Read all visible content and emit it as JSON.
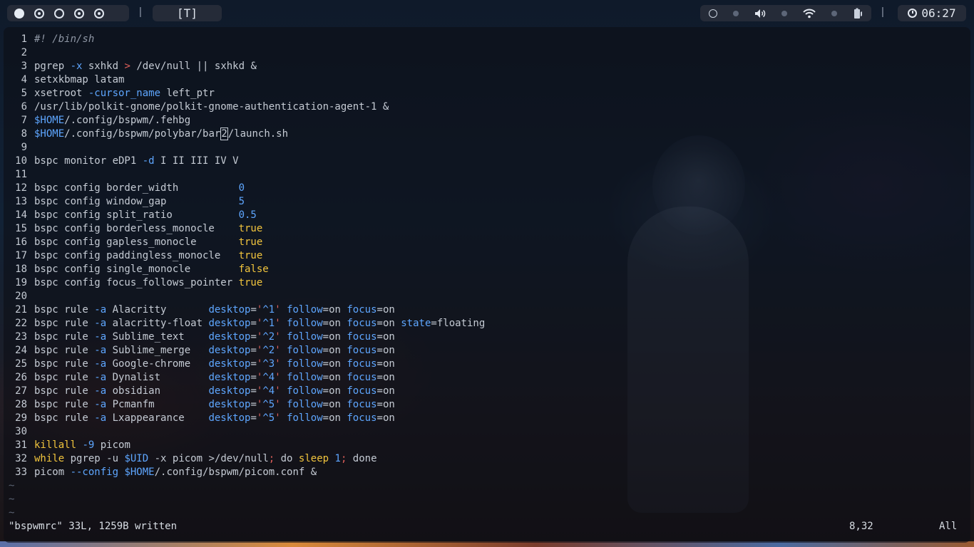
{
  "topbar": {
    "workspaces": [
      {
        "state": "active"
      },
      {
        "state": "occupied"
      },
      {
        "state": "empty"
      },
      {
        "state": "occupied"
      },
      {
        "state": "occupied"
      }
    ],
    "separator_left": "|",
    "separator_right": "|",
    "layout": "[T]",
    "icons": [
      "circle-icon",
      "dot-icon",
      "volume-icon",
      "dot-icon",
      "wifi-icon",
      "dot-icon",
      "battery-icon"
    ],
    "clock": "06:27"
  },
  "editor": {
    "lines": [
      {
        "n": "1",
        "segs": [
          [
            "c-com",
            "#! /bin/sh"
          ]
        ]
      },
      {
        "n": "2",
        "segs": []
      },
      {
        "n": "3",
        "segs": [
          [
            "",
            "pgrep "
          ],
          [
            "c-flag",
            "-x"
          ],
          [
            "",
            " sxhkd "
          ],
          [
            "c-op",
            ">"
          ],
          [
            "",
            " /dev/null || sxhkd &"
          ]
        ]
      },
      {
        "n": "4",
        "segs": [
          [
            "",
            "setxkbmap latam"
          ]
        ]
      },
      {
        "n": "5",
        "segs": [
          [
            "",
            "xsetroot "
          ],
          [
            "c-flag",
            "-cursor_name"
          ],
          [
            "",
            " left_ptr"
          ]
        ]
      },
      {
        "n": "6",
        "segs": [
          [
            "",
            "/usr/lib/polkit-gnome/polkit-gnome-authentication-agent-1 &"
          ]
        ]
      },
      {
        "n": "7",
        "segs": [
          [
            "c-var",
            "$HOME"
          ],
          [
            "",
            "/.config/bspwm/.fehbg"
          ]
        ]
      },
      {
        "n": "8",
        "segs": [
          [
            "c-var",
            "$HOME"
          ],
          [
            "",
            "/.config/bspwm/polybar/bar"
          ],
          [
            "cursor",
            "2"
          ],
          [
            "",
            "/launch.sh"
          ]
        ]
      },
      {
        "n": "9",
        "segs": []
      },
      {
        "n": "10",
        "segs": [
          [
            "",
            "bspc monitor eDP1 "
          ],
          [
            "c-flag",
            "-d"
          ],
          [
            "",
            " I II III IV V"
          ]
        ]
      },
      {
        "n": "11",
        "segs": []
      },
      {
        "n": "12",
        "segs": [
          [
            "",
            "bspc config border_width          "
          ],
          [
            "c-num",
            "0"
          ]
        ]
      },
      {
        "n": "13",
        "segs": [
          [
            "",
            "bspc config window_gap            "
          ],
          [
            "c-num",
            "5"
          ]
        ]
      },
      {
        "n": "14",
        "segs": [
          [
            "",
            "bspc config split_ratio           "
          ],
          [
            "c-num",
            "0.5"
          ]
        ]
      },
      {
        "n": "15",
        "segs": [
          [
            "",
            "bspc config borderless_monocle    "
          ],
          [
            "c-bool",
            "true"
          ]
        ]
      },
      {
        "n": "16",
        "segs": [
          [
            "",
            "bspc config gapless_monocle       "
          ],
          [
            "c-bool",
            "true"
          ]
        ]
      },
      {
        "n": "17",
        "segs": [
          [
            "",
            "bspc config paddingless_monocle   "
          ],
          [
            "c-bool",
            "true"
          ]
        ]
      },
      {
        "n": "18",
        "segs": [
          [
            "",
            "bspc config single_monocle        "
          ],
          [
            "c-bool",
            "false"
          ]
        ]
      },
      {
        "n": "19",
        "segs": [
          [
            "",
            "bspc config focus_follows_pointer "
          ],
          [
            "c-bool",
            "true"
          ]
        ]
      },
      {
        "n": "20",
        "segs": []
      },
      {
        "n": "21",
        "segs": [
          [
            "",
            "bspc rule "
          ],
          [
            "c-flag",
            "-a"
          ],
          [
            "",
            " Alacritty       "
          ],
          [
            "c-key",
            "desktop"
          ],
          [
            "",
            "="
          ],
          [
            "c-str",
            "'"
          ],
          [
            "c-strv",
            "^1"
          ],
          [
            "c-str",
            "'"
          ],
          [
            "",
            " "
          ],
          [
            "c-key",
            "follow"
          ],
          [
            "",
            "=on "
          ],
          [
            "c-key",
            "focus"
          ],
          [
            "",
            "=on"
          ]
        ]
      },
      {
        "n": "22",
        "segs": [
          [
            "",
            "bspc rule "
          ],
          [
            "c-flag",
            "-a"
          ],
          [
            "",
            " alacritty-float "
          ],
          [
            "c-key",
            "desktop"
          ],
          [
            "",
            "="
          ],
          [
            "c-str",
            "'"
          ],
          [
            "c-strv",
            "^1"
          ],
          [
            "c-str",
            "'"
          ],
          [
            "",
            " "
          ],
          [
            "c-key",
            "follow"
          ],
          [
            "",
            "=on "
          ],
          [
            "c-key",
            "focus"
          ],
          [
            "",
            "=on "
          ],
          [
            "c-key",
            "state"
          ],
          [
            "",
            "=floating"
          ]
        ]
      },
      {
        "n": "23",
        "segs": [
          [
            "",
            "bspc rule "
          ],
          [
            "c-flag",
            "-a"
          ],
          [
            "",
            " Sublime_text    "
          ],
          [
            "c-key",
            "desktop"
          ],
          [
            "",
            "="
          ],
          [
            "c-str",
            "'"
          ],
          [
            "c-strv",
            "^2"
          ],
          [
            "c-str",
            "'"
          ],
          [
            "",
            " "
          ],
          [
            "c-key",
            "follow"
          ],
          [
            "",
            "=on "
          ],
          [
            "c-key",
            "focus"
          ],
          [
            "",
            "=on"
          ]
        ]
      },
      {
        "n": "24",
        "segs": [
          [
            "",
            "bspc rule "
          ],
          [
            "c-flag",
            "-a"
          ],
          [
            "",
            " Sublime_merge   "
          ],
          [
            "c-key",
            "desktop"
          ],
          [
            "",
            "="
          ],
          [
            "c-str",
            "'"
          ],
          [
            "c-strv",
            "^2"
          ],
          [
            "c-str",
            "'"
          ],
          [
            "",
            " "
          ],
          [
            "c-key",
            "follow"
          ],
          [
            "",
            "=on "
          ],
          [
            "c-key",
            "focus"
          ],
          [
            "",
            "=on"
          ]
        ]
      },
      {
        "n": "25",
        "segs": [
          [
            "",
            "bspc rule "
          ],
          [
            "c-flag",
            "-a"
          ],
          [
            "",
            " Google-chrome   "
          ],
          [
            "c-key",
            "desktop"
          ],
          [
            "",
            "="
          ],
          [
            "c-str",
            "'"
          ],
          [
            "c-strv",
            "^3"
          ],
          [
            "c-str",
            "'"
          ],
          [
            "",
            " "
          ],
          [
            "c-key",
            "follow"
          ],
          [
            "",
            "=on "
          ],
          [
            "c-key",
            "focus"
          ],
          [
            "",
            "=on"
          ]
        ]
      },
      {
        "n": "26",
        "segs": [
          [
            "",
            "bspc rule "
          ],
          [
            "c-flag",
            "-a"
          ],
          [
            "",
            " Dynalist        "
          ],
          [
            "c-key",
            "desktop"
          ],
          [
            "",
            "="
          ],
          [
            "c-str",
            "'"
          ],
          [
            "c-strv",
            "^4"
          ],
          [
            "c-str",
            "'"
          ],
          [
            "",
            " "
          ],
          [
            "c-key",
            "follow"
          ],
          [
            "",
            "=on "
          ],
          [
            "c-key",
            "focus"
          ],
          [
            "",
            "=on"
          ]
        ]
      },
      {
        "n": "27",
        "segs": [
          [
            "",
            "bspc rule "
          ],
          [
            "c-flag",
            "-a"
          ],
          [
            "",
            " obsidian        "
          ],
          [
            "c-key",
            "desktop"
          ],
          [
            "",
            "="
          ],
          [
            "c-str",
            "'"
          ],
          [
            "c-strv",
            "^4"
          ],
          [
            "c-str",
            "'"
          ],
          [
            "",
            " "
          ],
          [
            "c-key",
            "follow"
          ],
          [
            "",
            "=on "
          ],
          [
            "c-key",
            "focus"
          ],
          [
            "",
            "=on"
          ]
        ]
      },
      {
        "n": "28",
        "segs": [
          [
            "",
            "bspc rule "
          ],
          [
            "c-flag",
            "-a"
          ],
          [
            "",
            " Pcmanfm         "
          ],
          [
            "c-key",
            "desktop"
          ],
          [
            "",
            "="
          ],
          [
            "c-str",
            "'"
          ],
          [
            "c-strv",
            "^5"
          ],
          [
            "c-str",
            "'"
          ],
          [
            "",
            " "
          ],
          [
            "c-key",
            "follow"
          ],
          [
            "",
            "=on "
          ],
          [
            "c-key",
            "focus"
          ],
          [
            "",
            "=on"
          ]
        ]
      },
      {
        "n": "29",
        "segs": [
          [
            "",
            "bspc rule "
          ],
          [
            "c-flag",
            "-a"
          ],
          [
            "",
            " Lxappearance    "
          ],
          [
            "c-key",
            "desktop"
          ],
          [
            "",
            "="
          ],
          [
            "c-str",
            "'"
          ],
          [
            "c-strv",
            "^5"
          ],
          [
            "c-str",
            "'"
          ],
          [
            "",
            " "
          ],
          [
            "c-key",
            "follow"
          ],
          [
            "",
            "=on "
          ],
          [
            "c-key",
            "focus"
          ],
          [
            "",
            "=on"
          ]
        ]
      },
      {
        "n": "30",
        "segs": []
      },
      {
        "n": "31",
        "segs": [
          [
            "c-kw",
            "killall"
          ],
          [
            "",
            " "
          ],
          [
            "c-flag",
            "-9"
          ],
          [
            "",
            " picom"
          ]
        ]
      },
      {
        "n": "32",
        "segs": [
          [
            "c-kw",
            "while"
          ],
          [
            "",
            " pgrep -u "
          ],
          [
            "c-var",
            "$UID"
          ],
          [
            "",
            " -x picom >/dev/null"
          ],
          [
            "c-op",
            ";"
          ],
          [
            "",
            " do "
          ],
          [
            "c-kw",
            "sleep"
          ],
          [
            "",
            " "
          ],
          [
            "c-num",
            "1"
          ],
          [
            "c-op",
            ";"
          ],
          [
            "",
            " done"
          ]
        ]
      },
      {
        "n": "33",
        "segs": [
          [
            "",
            "picom "
          ],
          [
            "c-flag",
            "--config"
          ],
          [
            "",
            " "
          ],
          [
            "c-var",
            "$HOME"
          ],
          [
            "",
            "/.config/bspwm/picom.conf &"
          ]
        ]
      }
    ],
    "tildes": [
      "~",
      "~",
      "~"
    ],
    "cmdline": {
      "message": "\"bspwmrc\" 33L, 1259B written",
      "position": "8,32",
      "scroll": "All"
    }
  }
}
